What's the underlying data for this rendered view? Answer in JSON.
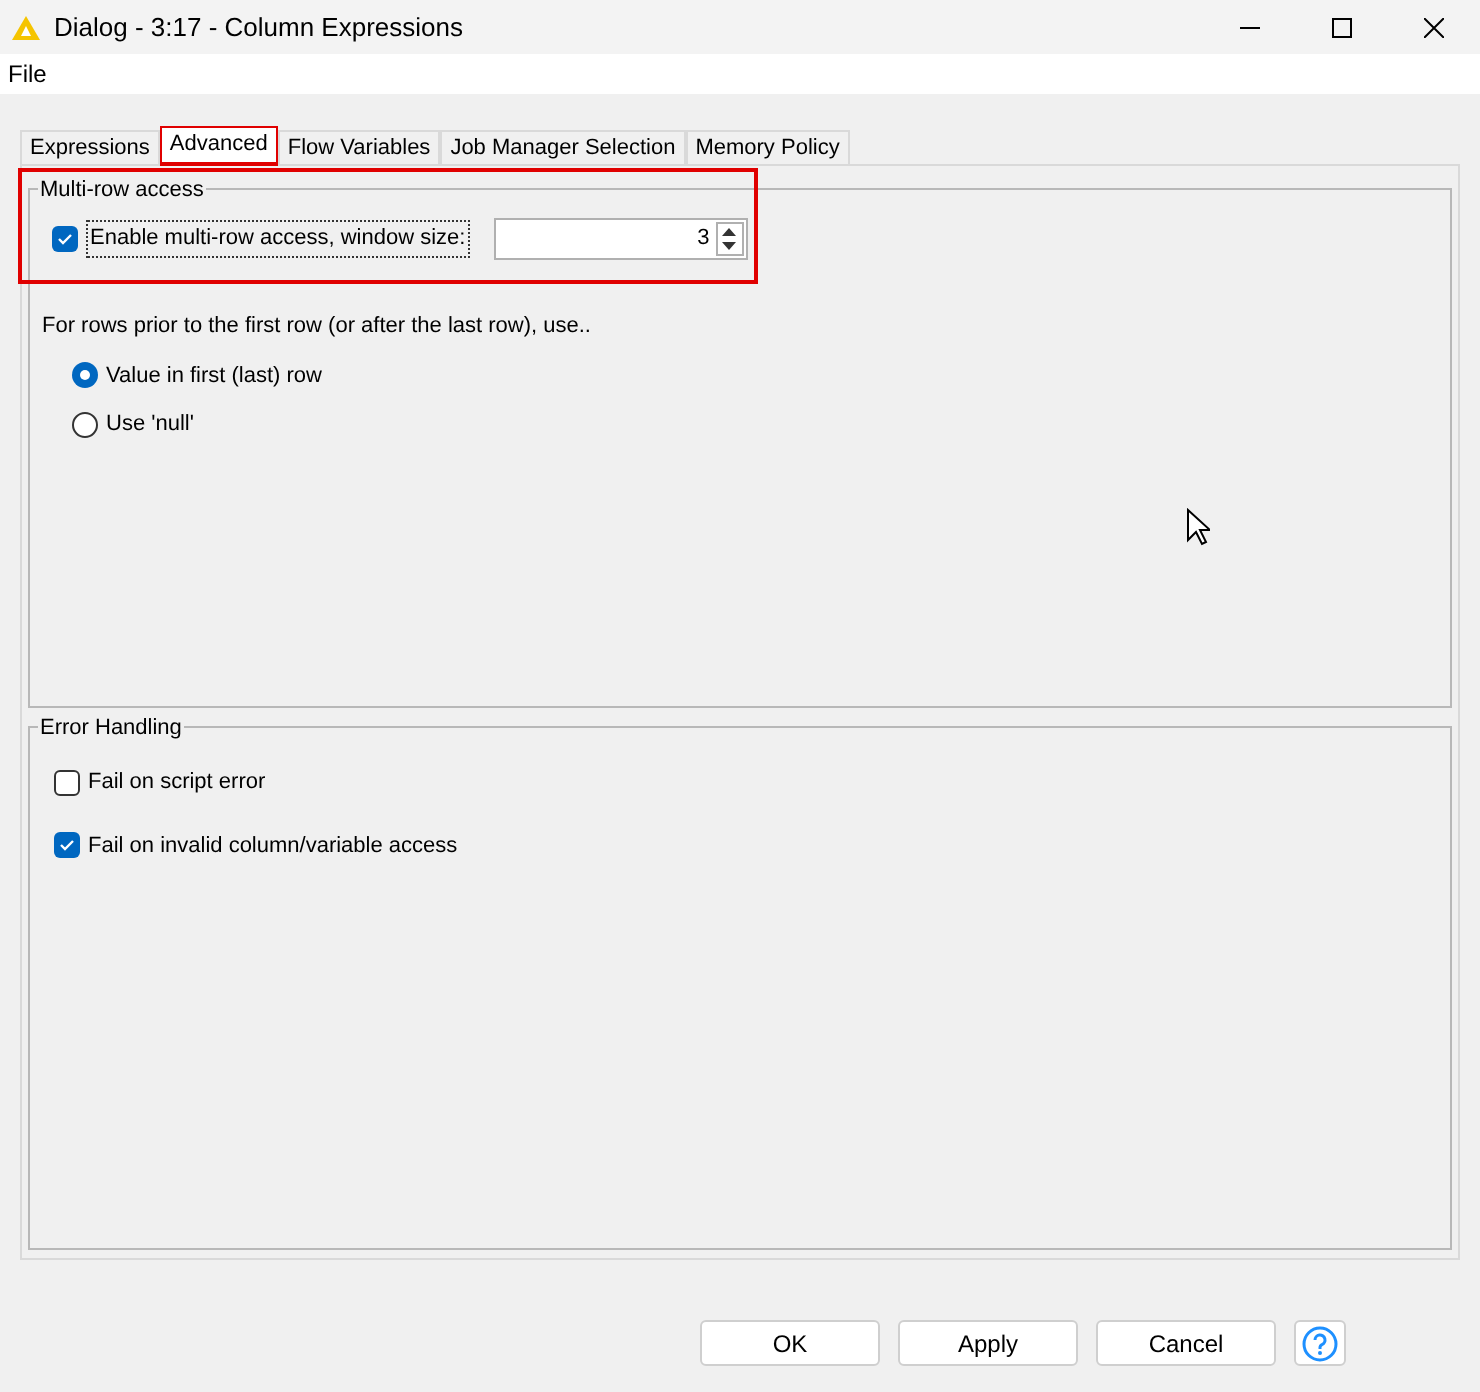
{
  "window": {
    "title": "Dialog - 3:17 - Column Expressions"
  },
  "menu": [
    "File"
  ],
  "tabs": [
    {
      "label": "Expressions",
      "selected": false,
      "highlighted": false
    },
    {
      "label": "Advanced",
      "selected": true,
      "highlighted": true
    },
    {
      "label": "Flow Variables",
      "selected": false,
      "highlighted": false
    },
    {
      "label": "Job Manager Selection",
      "selected": false,
      "highlighted": false
    },
    {
      "label": "Memory Policy",
      "selected": false,
      "highlighted": false
    }
  ],
  "multi_row": {
    "title": "Multi-row access",
    "highlighted": true,
    "enable": {
      "label": "Enable multi-row access, window size:",
      "checked": true
    },
    "window_size": "3",
    "prompt": "For rows prior to the first row (or after the last row), use..",
    "options": [
      {
        "label": "Value in first (last) row",
        "selected": true
      },
      {
        "label": "Use 'null'",
        "selected": false
      }
    ]
  },
  "error_handling": {
    "title": "Error Handling",
    "options": [
      {
        "label": "Fail on script error",
        "checked": false
      },
      {
        "label": "Fail on invalid column/variable access",
        "checked": true
      }
    ]
  },
  "buttons": [
    "OK",
    "Apply",
    "Cancel"
  ]
}
